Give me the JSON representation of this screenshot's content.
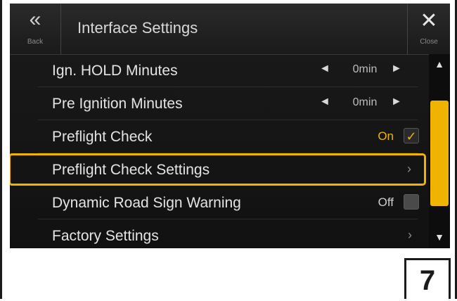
{
  "header": {
    "back_glyph": "«",
    "back_label": "Back",
    "title": "Interface Settings",
    "close_glyph": "✕",
    "close_label": "Close"
  },
  "rows": [
    {
      "label": "Ign. HOLD Minutes",
      "value": "0min",
      "left": "◄",
      "right": "►"
    },
    {
      "label": "Pre Ignition Minutes",
      "value": "0min",
      "left": "◄",
      "right": "►"
    },
    {
      "label": "Preflight Check",
      "status": "On",
      "check": "✓"
    },
    {
      "label": "Preflight Check Settings",
      "chevron": "›"
    },
    {
      "label": "Dynamic Road Sign Warning",
      "status": "Off"
    },
    {
      "label": "Factory Settings",
      "chevron": "›"
    }
  ],
  "scroll": {
    "up": "▲",
    "down": "▼"
  },
  "figure_number": "7",
  "colors": {
    "accent": "#f0b400",
    "background": "#151515",
    "text": "#e4e4e4"
  }
}
